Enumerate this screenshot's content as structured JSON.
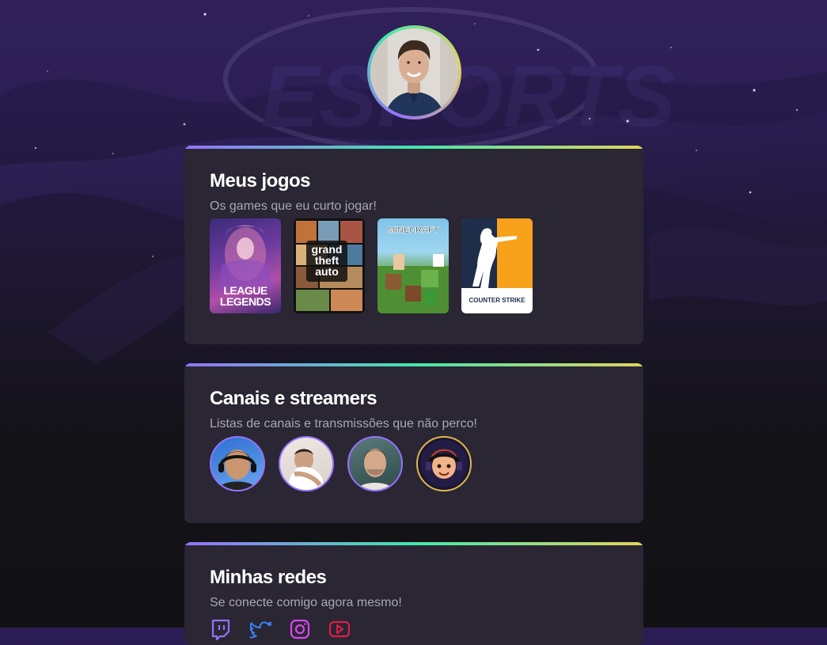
{
  "profile": {
    "avatar_icon": "profile-photo"
  },
  "games_card": {
    "title": "Meus jogos",
    "subtitle": "Os games que eu curto jogar!",
    "games": [
      {
        "name": "League of Legends",
        "cover_text_1": "LEAGUE",
        "cover_text_2": "LEGENDS",
        "cover_small": "OF"
      },
      {
        "name": "Grand Theft Auto V",
        "cover_text": "grand theft auto"
      },
      {
        "name": "Minecraft",
        "cover_text": "MINECRAFT"
      },
      {
        "name": "Counter-Strike",
        "cover_text": "COUNTER STRIKE"
      }
    ]
  },
  "streamers_card": {
    "title": "Canais e streamers",
    "subtitle": "Listas de canais e transmissões que não perco!",
    "streamers": [
      {
        "icon": "streamer-avatar-1"
      },
      {
        "icon": "streamer-avatar-2"
      },
      {
        "icon": "streamer-avatar-3"
      },
      {
        "icon": "streamer-avatar-4"
      }
    ]
  },
  "social_card": {
    "title": "Minhas redes",
    "subtitle": "Se conecte comigo agora mesmo!",
    "links": [
      {
        "icon": "twitch-icon",
        "color": "#9572fc"
      },
      {
        "icon": "twitter-icon",
        "color": "#3b82f6"
      },
      {
        "icon": "instagram-icon",
        "color": "#d946ef"
      },
      {
        "icon": "youtube-icon",
        "color": "#e11d48"
      }
    ]
  },
  "colors": {
    "gradient_start": "#9572fc",
    "gradient_mid": "#43e7ad",
    "gradient_end": "#e2d45c",
    "card_bg": "#2a2634",
    "muted_text": "#a8a8b3"
  }
}
